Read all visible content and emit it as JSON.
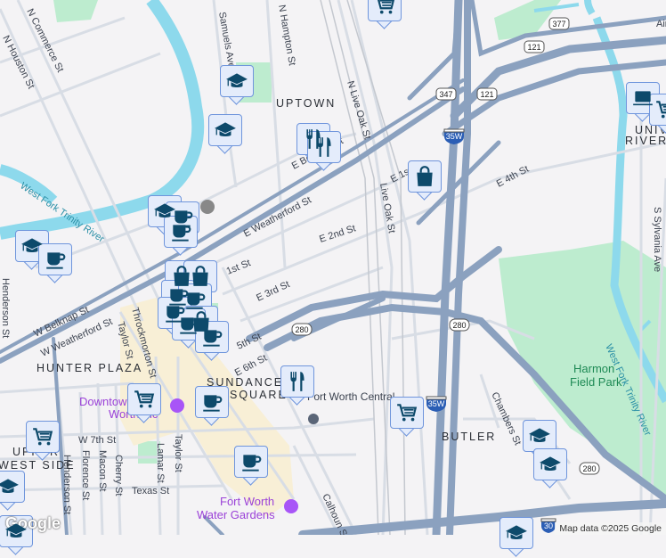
{
  "areas": {
    "uptown": "UPTOWN",
    "hunter_plaza": "HUNTER PLAZA",
    "sundance_1": "SUNDANCE",
    "sundance_2": "SQUARE",
    "upper_west_1": "UPPER",
    "upper_west_2": "WEST SIDE",
    "butler": "BUTLER",
    "univ_1": "UNIV",
    "univ_2": "RIVERSIDE"
  },
  "streets": [
    "N Commerce St",
    "N Houston St",
    "Samuels Ave",
    "N Hampton St",
    "N Live Oak St",
    "Live Oak St",
    "E Weatherford St",
    "E 2nd St",
    "E 4th St",
    "E 1st St",
    "1st St",
    "E 3rd St",
    "W Belknap St",
    "W Weatherford St",
    "Throckmorton St",
    "Taylor St",
    "E 6th St",
    "5th St",
    "W 7th St",
    "Henderson St",
    "Florence St",
    "Macon St",
    "Cherry St",
    "Lamar St",
    "Taylor St",
    "Texas St",
    "Calhoun St",
    "Chambers St",
    "S Sylvania Ave",
    "Henderson St",
    "Airport Fwy",
    "E Belknap St"
  ],
  "pois": {
    "downtown_1": "Downtown Fort",
    "downtown_2": "Worth Inc",
    "water_1": "Fort Worth",
    "water_2": "Water Gardens",
    "central": "Fort Worth Central"
  },
  "parks": {
    "harmon_1": "Harmon",
    "harmon_2": "Field Park"
  },
  "rivers": {
    "west": "West Fork Trinity River",
    "east": "West Fork Trinity River"
  },
  "shields": [
    "377",
    "121",
    "121",
    "347",
    "35W",
    "280",
    "280",
    "35W",
    "280",
    "30"
  ],
  "pins": [
    {
      "type": "cart",
      "icon": "shopping-cart-icon"
    },
    {
      "type": "grad",
      "icon": "graduation-cap-icon"
    },
    {
      "type": "grad",
      "icon": "graduation-cap-icon"
    },
    {
      "type": "fork",
      "icon": "restaurant-icon"
    },
    {
      "type": "fork",
      "icon": "restaurant-icon"
    },
    {
      "type": "bag",
      "icon": "shopping-bag-icon"
    },
    {
      "type": "laptop",
      "icon": "laptop-icon"
    },
    {
      "type": "cart",
      "icon": "shopping-cart-icon"
    },
    {
      "type": "grad",
      "icon": "graduation-cap-icon"
    },
    {
      "type": "coffee",
      "icon": "coffee-icon"
    },
    {
      "type": "coffee",
      "icon": "coffee-icon"
    },
    {
      "type": "grad",
      "icon": "graduation-cap-icon"
    },
    {
      "type": "coffee",
      "icon": "coffee-icon"
    },
    {
      "type": "bag",
      "icon": "shopping-bag-icon"
    },
    {
      "type": "bag",
      "icon": "shopping-bag-icon"
    },
    {
      "type": "coffee",
      "icon": "coffee-icon"
    },
    {
      "type": "coffee",
      "icon": "coffee-icon"
    },
    {
      "type": "coffee",
      "icon": "coffee-icon"
    },
    {
      "type": "bag",
      "icon": "shopping-bag-icon"
    },
    {
      "type": "coffee",
      "icon": "coffee-icon"
    },
    {
      "type": "coffee",
      "icon": "coffee-icon"
    },
    {
      "type": "fork",
      "icon": "restaurant-icon"
    },
    {
      "type": "cart",
      "icon": "shopping-cart-icon"
    },
    {
      "type": "coffee",
      "icon": "coffee-icon"
    },
    {
      "type": "cart",
      "icon": "shopping-cart-icon"
    },
    {
      "type": "cart",
      "icon": "shopping-cart-icon"
    },
    {
      "type": "coffee",
      "icon": "coffee-icon"
    },
    {
      "type": "grad",
      "icon": "graduation-cap-icon"
    },
    {
      "type": "grad",
      "icon": "graduation-cap-icon"
    },
    {
      "type": "grad",
      "icon": "graduation-cap-icon"
    },
    {
      "type": "grad",
      "icon": "graduation-cap-icon"
    },
    {
      "type": "grad",
      "icon": "graduation-cap-icon"
    }
  ],
  "attribution": "Map data ©2025 Google",
  "logo": "Google",
  "colors": {
    "highway": "#8ba1bf",
    "road": "#d5dbe3",
    "water": "#8dd9ec",
    "park": "#bdeccf",
    "downtown": "#f8efd6",
    "pin_fill": "#e4ecfb",
    "pin_border": "#6f95dc",
    "icon": "#0d4a6b"
  }
}
